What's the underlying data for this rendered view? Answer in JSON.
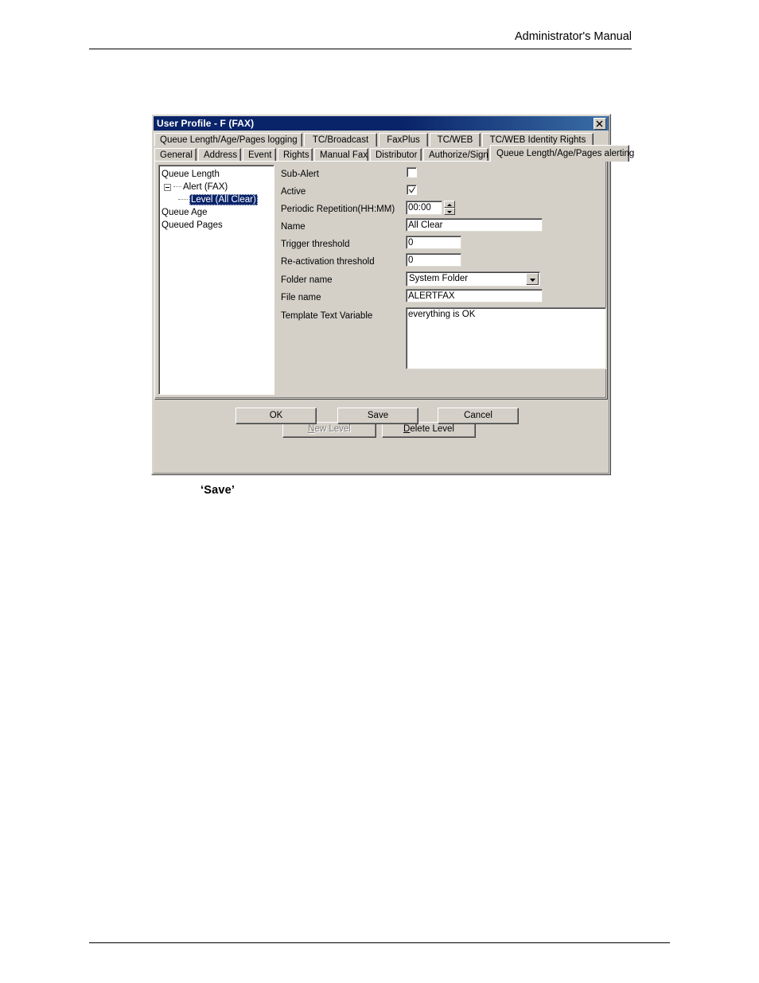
{
  "document": {
    "header_title": "Administrator's Manual",
    "caption": "‘Save’"
  },
  "dialog": {
    "title": "User Profile - F (FAX)",
    "close_icon": "close-icon",
    "tabs_row1": [
      {
        "label": "Queue Length/Age/Pages logging",
        "selected": false
      },
      {
        "label": "TC/Broadcast",
        "selected": false
      },
      {
        "label": "FaxPlus",
        "selected": false
      },
      {
        "label": "TC/WEB",
        "selected": false
      },
      {
        "label": "TC/WEB Identity Rights",
        "selected": false
      }
    ],
    "tabs_row2": [
      {
        "label": "General",
        "selected": false
      },
      {
        "label": "Address",
        "selected": false
      },
      {
        "label": "Event",
        "selected": false
      },
      {
        "label": "Rights",
        "selected": false
      },
      {
        "label": "Manual Fax",
        "selected": false
      },
      {
        "label": "Distributor",
        "selected": false
      },
      {
        "label": "Authorize/Sign",
        "selected": false
      },
      {
        "label": "Queue Length/Age/Pages alerting",
        "selected": true
      }
    ],
    "tree": {
      "nodes": [
        {
          "label": "Queue Length",
          "level": 1,
          "selected": false,
          "expander": false
        },
        {
          "label": "Alert (FAX)",
          "level": 2,
          "selected": false,
          "expander": true
        },
        {
          "label": "Level (All Clear)",
          "level": 3,
          "selected": true,
          "expander": false
        },
        {
          "label": "Queue Age",
          "level": 1,
          "selected": false,
          "expander": false
        },
        {
          "label": "Queued Pages",
          "level": 1,
          "selected": false,
          "expander": false
        }
      ]
    },
    "form": {
      "sub_alert_label": "Sub-Alert",
      "sub_alert_checked": false,
      "active_label": "Active",
      "active_checked": true,
      "periodic_label": "Periodic Repetition(HH:MM)",
      "periodic_value": "00:00",
      "name_label": "Name",
      "name_value": "All Clear",
      "trigger_label": "Trigger threshold",
      "trigger_value": "0",
      "reactivation_label": "Re-activation threshold",
      "reactivation_value": "0",
      "folder_label": "Folder name",
      "folder_value": "System Folder",
      "file_label": "File name",
      "file_value": "ALERTFAX",
      "template_label": "Template Text Variable",
      "template_value": "everything is OK"
    },
    "level_buttons": {
      "new_level_accel": "N",
      "new_level_rest": "ew Level",
      "new_level_enabled": false,
      "delete_level_accel": "D",
      "delete_level_rest": "elete Level",
      "delete_level_enabled": true
    },
    "footer_buttons": {
      "ok": "OK",
      "save": "Save",
      "cancel": "Cancel"
    }
  }
}
